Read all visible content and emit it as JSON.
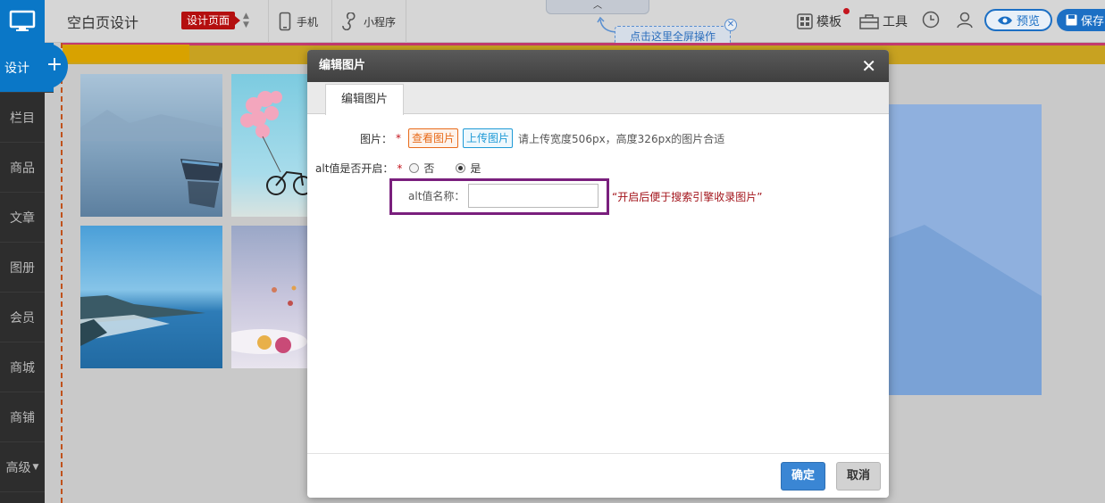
{
  "topbar": {
    "page_name": "空白页设计",
    "design_tag": "设计页面",
    "mobile_label": "手机",
    "miniprogram_label": "小程序",
    "fullscreen_tip": "点击这里全屏操作",
    "template_label": "模板",
    "tools_label": "工具",
    "preview_label": "预览",
    "save_label": "保存"
  },
  "sidebar": {
    "items": [
      {
        "label": "设计"
      },
      {
        "label": "栏目"
      },
      {
        "label": "商品"
      },
      {
        "label": "文章"
      },
      {
        "label": "图册"
      },
      {
        "label": "会员"
      },
      {
        "label": "商城"
      },
      {
        "label": "商铺"
      },
      {
        "label": "高级"
      }
    ]
  },
  "modal": {
    "title": "编辑图片",
    "tab": "编辑图片",
    "image_label": "图片：",
    "view_image": "查看图片",
    "upload_image": "上传图片",
    "image_hint": "请上传宽度506px，高度326px的图片合适",
    "alt_toggle_label": "alt值是否开启：",
    "alt_no": "否",
    "alt_yes": "是",
    "alt_name_label": "alt值名称：",
    "alt_name_value": "",
    "alt_note": "“开启后便于搜索引擎收录图片”",
    "ok": "确定",
    "cancel": "取消"
  },
  "colors": {
    "brand_blue": "#0a77c7",
    "highlight_box": "#7a1f7d",
    "required_red": "#c4141d"
  }
}
